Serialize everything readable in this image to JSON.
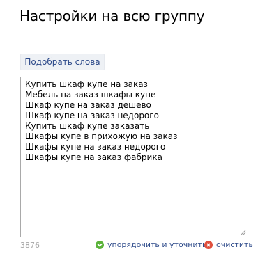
{
  "header": {
    "title": "Настройки на всю группу"
  },
  "pick_words_button": {
    "label": "Подобрать слова"
  },
  "keywords": {
    "lines": [
      "Купить шкаф купе на заказ",
      "Мебель на заказ шкафы купе",
      "Шкаф купе на заказ дешево",
      "Шкаф купе на заказ недорого",
      "Купить шкаф купе заказать",
      "Шкафы купе в прихожую на заказ",
      "Шкафы купе на заказ недорого",
      "Шкафы купе на заказ фабрика"
    ]
  },
  "footer": {
    "counter": "3876",
    "order_label": "упорядочить и уточнить",
    "clear_label": "очистить"
  },
  "colors": {
    "link": "#2d4a8a",
    "button_bg": "#eef1f5",
    "order_icon": "#5bb33a",
    "clear_icon": "#e0503e"
  },
  "icons": {
    "order": "chevron-down-icon",
    "clear": "close-icon"
  }
}
